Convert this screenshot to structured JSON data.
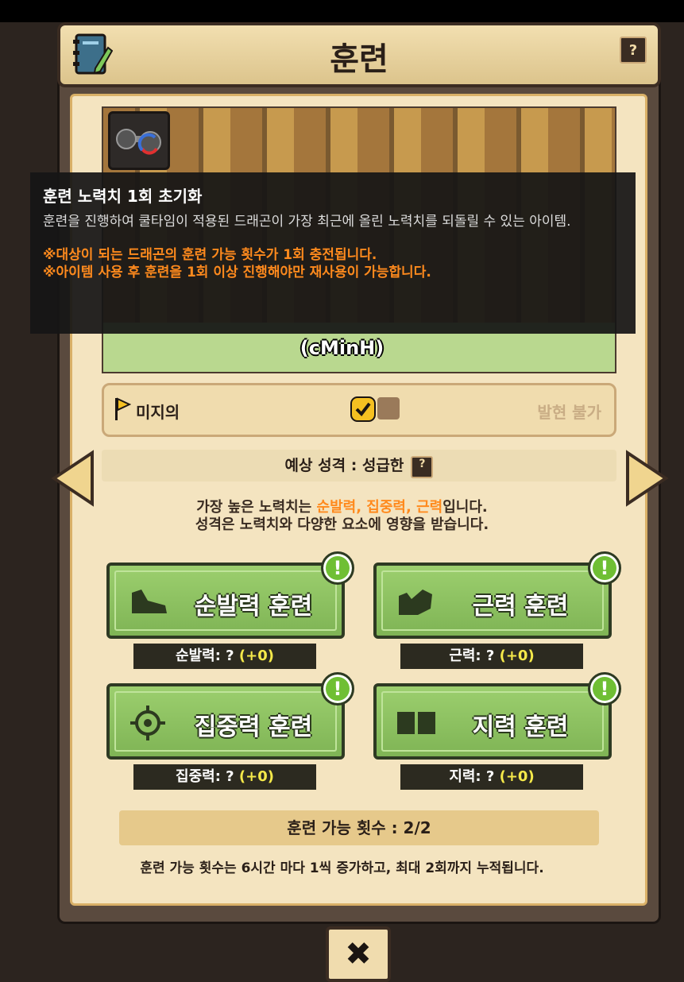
{
  "header": {
    "title": "훈련",
    "help": "?"
  },
  "scene": {
    "dragon_name": "(cMinH)"
  },
  "tooltip": {
    "title": "훈련 노력치 1회 초기화",
    "desc": "훈련을 진행하여 쿨타임이 적용된 드래곤이 가장 최근에 올린 노력치를 되돌릴 수 있는 아이템.",
    "warn1": "※대상이 되는 드래곤의 훈련 가능 횟수가 1회 충전됩니다.",
    "warn2": "※아이템 사용 후 훈련을 1회 이상 진행해야만 재사용이 가능합니다."
  },
  "trait": {
    "label": "미지의",
    "status": "발현 불가"
  },
  "personality": {
    "text": "예상 성격 : 성급한",
    "help": "?"
  },
  "info": {
    "line1_prefix": "가장 높은 노력치는 ",
    "line1_highlight": "순발력, 집중력, 근력",
    "line1_suffix": "입니다.",
    "line2": "성격은 노력치와 다양한 요소에 영향을 받습니다."
  },
  "trainings": [
    {
      "label": "순발력 훈련",
      "stat": "순발력: ?",
      "plus": "(+0)",
      "icon": "shoe-icon"
    },
    {
      "label": "근력 훈련",
      "stat": "근력: ?",
      "plus": "(+0)",
      "icon": "muscle-icon"
    },
    {
      "label": "집중력 훈련",
      "stat": "집중력: ?",
      "plus": "(+0)",
      "icon": "target-icon"
    },
    {
      "label": "지력 훈련",
      "stat": "지력: ?",
      "plus": "(+0)",
      "icon": "book-icon"
    }
  ],
  "notice_mark": "!",
  "count": {
    "text": "훈련 가능 횟수 : 2/2",
    "note": "훈련 가능 횟수는 6시간 마다 1씩 증가하고, 최대 2회까지 누적됩니다."
  },
  "close_label": "✖",
  "colors": {
    "accent_orange": "#ff8a1d",
    "button_green": "#8cc462",
    "plus_yellow": "#f5e94a"
  }
}
